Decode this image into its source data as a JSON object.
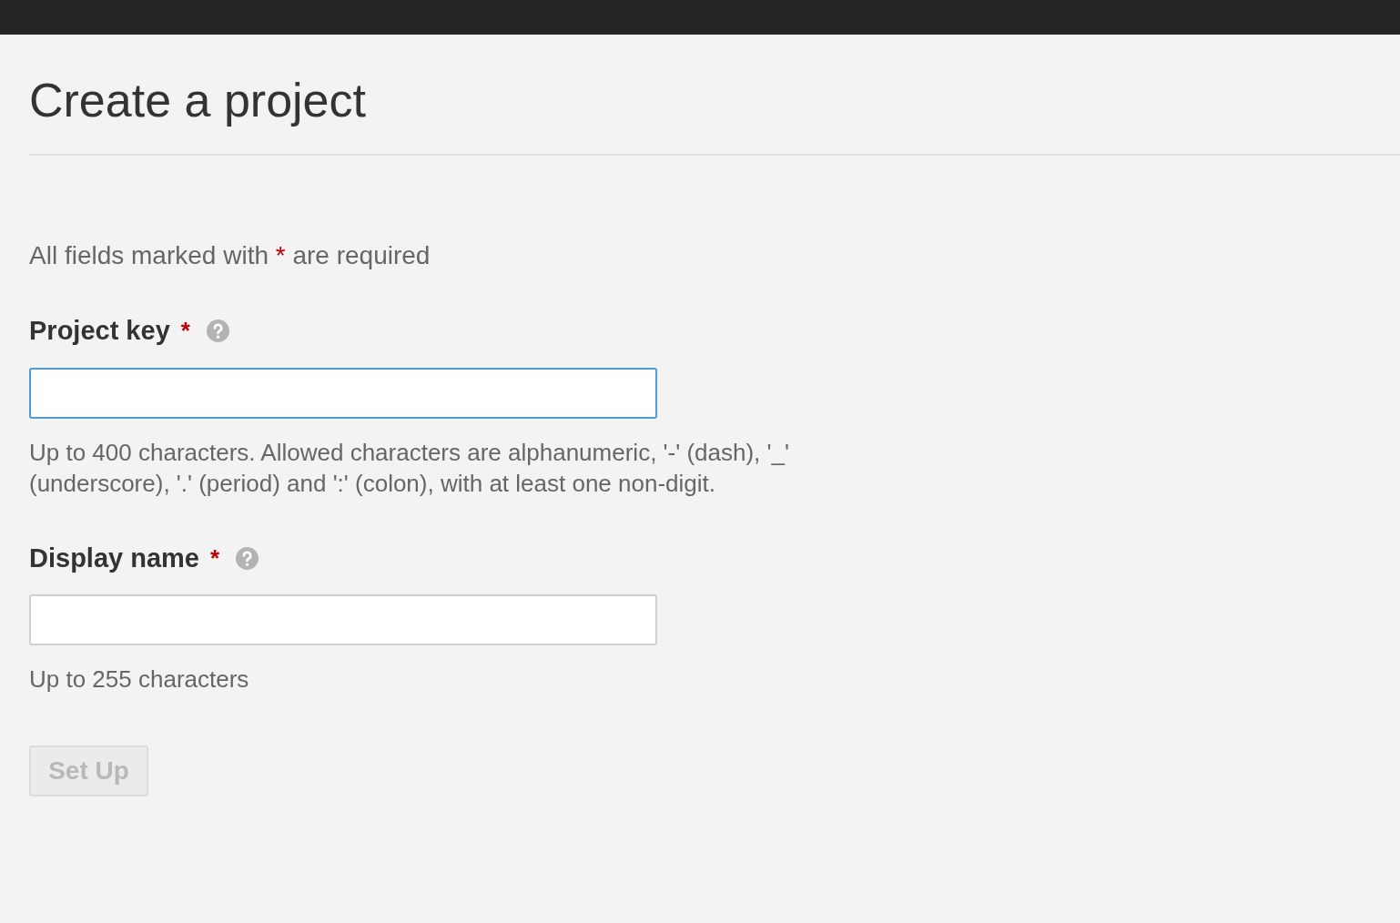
{
  "page": {
    "title": "Create a project"
  },
  "required_note": {
    "before": "All fields marked with",
    "mark": "*",
    "after": "are required"
  },
  "fields": [
    {
      "label": "Project key",
      "required_mark": "*",
      "focused": true,
      "help": "Up to 400 characters. Allowed characters are alphanumeric, '-' (dash), '_' (underscore), '.' (period) and ':' (colon), with at least one non-digit."
    },
    {
      "label": "Display name",
      "required_mark": "*",
      "focused": false,
      "help": "Up to 255 characters"
    }
  ],
  "submit": {
    "label": "Set Up",
    "disabled": true
  }
}
